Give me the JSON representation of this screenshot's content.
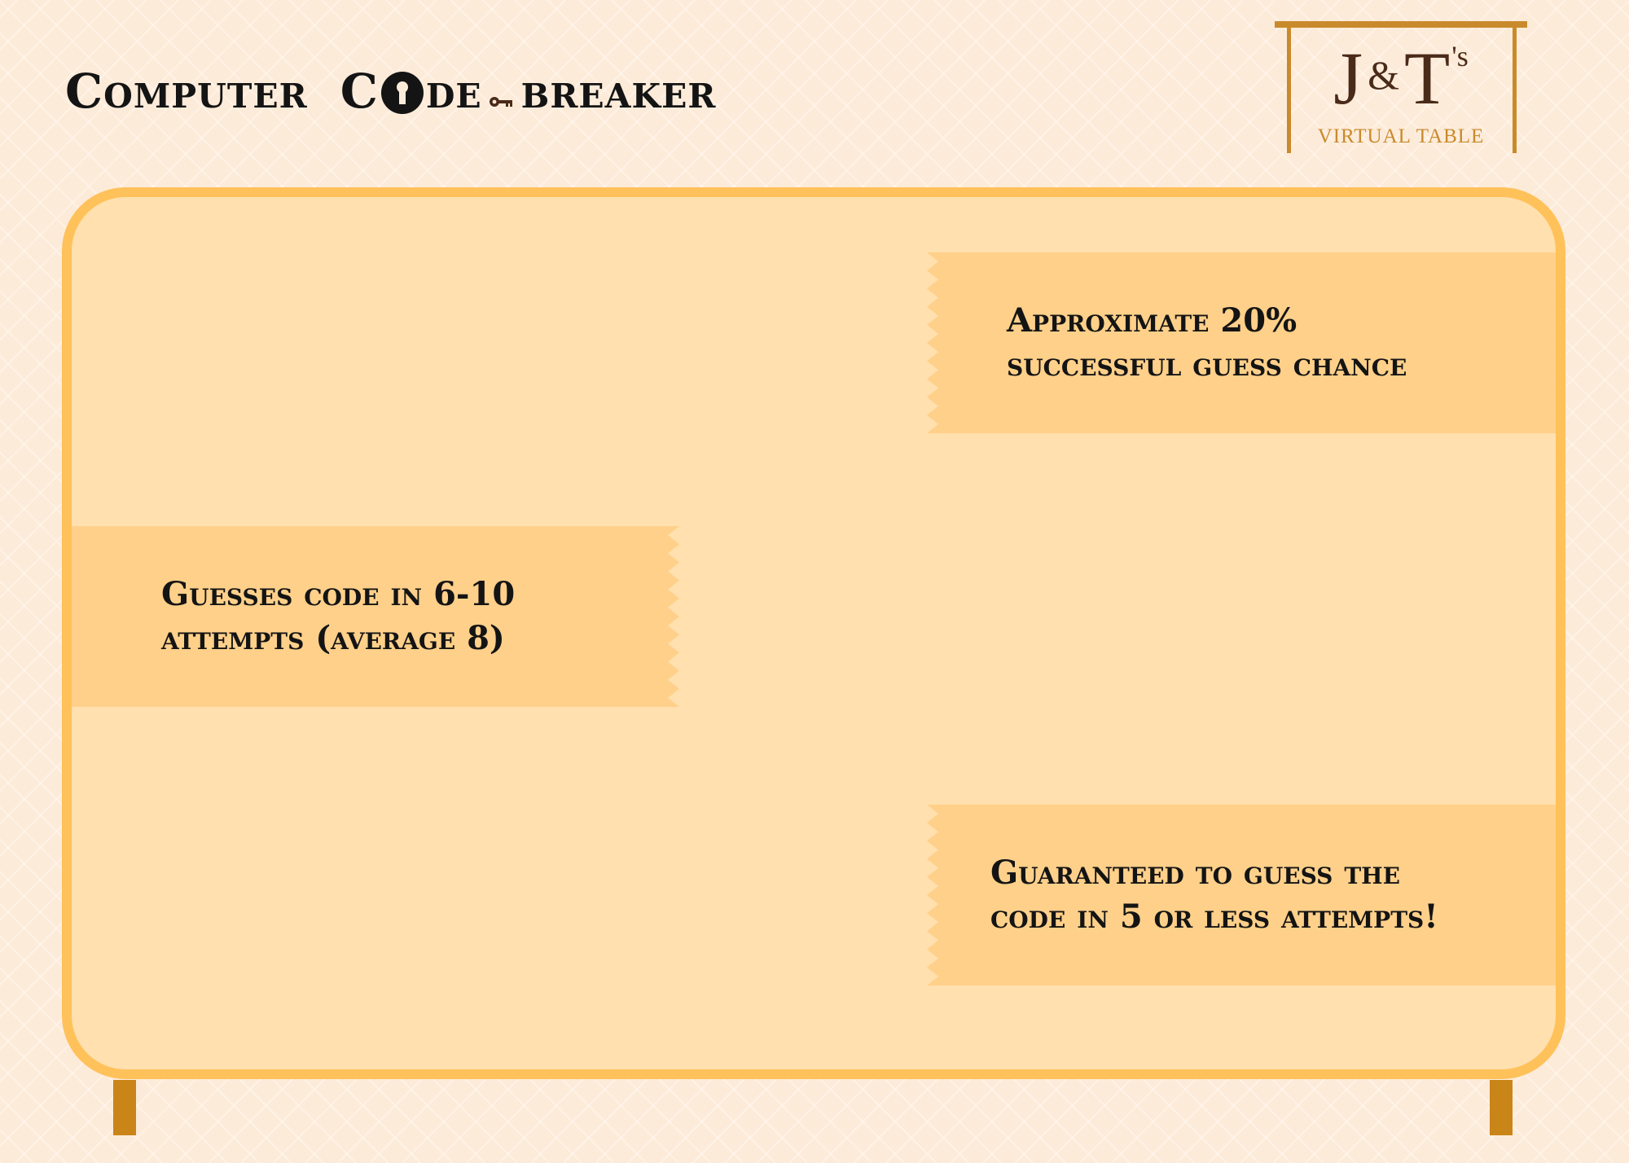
{
  "header": {
    "title_part1": "Computer",
    "title_part2_start": "C",
    "title_part2_end": "de",
    "title_part3": "breaker"
  },
  "logo": {
    "letter_j": "J",
    "ampersand": "&",
    "letter_t": "T",
    "suffix": "'s",
    "subtitle": "VIRTUAL TABLE"
  },
  "board": {
    "banners": [
      {
        "line1": "Approximate 20%",
        "line2": "successful guess chance"
      },
      {
        "line1": "Guesses code in 6-10",
        "line2": "attempts (average 8)"
      },
      {
        "line1": "Guaranteed to guess the",
        "line2": "code in 5 or less attempts!"
      }
    ]
  },
  "colors": {
    "background": "#fdebd9",
    "board_fill": "#ffe0ae",
    "board_border": "#ffc15a",
    "banner_fill": "#ffd08a",
    "legs": "#ca8519",
    "logo_gold": "#c98a2b",
    "logo_brown": "#4a2a18",
    "text": "#141414"
  },
  "icons": [
    "keyhole-icon",
    "key-icon"
  ]
}
